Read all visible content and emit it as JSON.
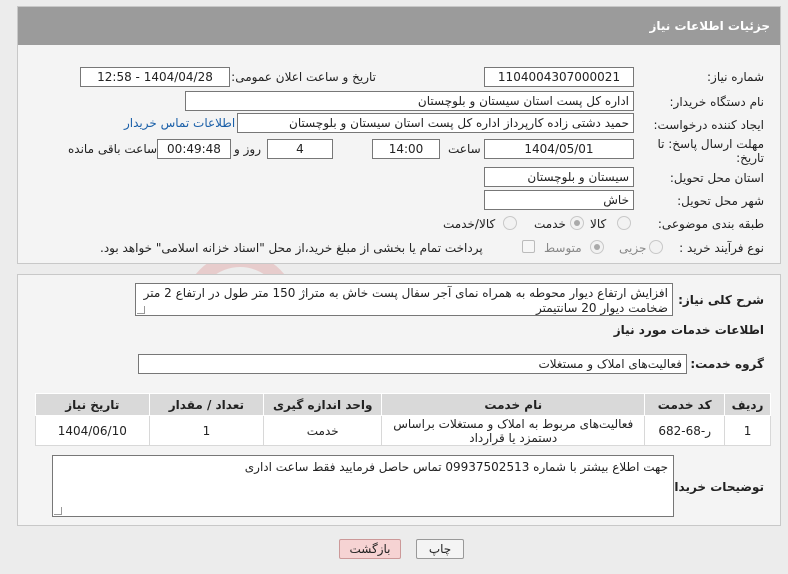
{
  "header": {
    "title": "جزئیات اطلاعات نیاز"
  },
  "fields": {
    "need_number_label": "شماره نیاز:",
    "need_number": "1104004307000021",
    "announce_label": "تاریخ و ساعت اعلان عمومی:",
    "announce_value": "1404/04/28 - 12:58",
    "buyer_org_label": "نام دستگاه خریدار:",
    "buyer_org": "اداره کل پست استان سیستان و بلوچستان",
    "requester_label": "ایجاد کننده درخواست:",
    "requester": "حمید دشتی زاده کارپرداز اداره کل پست استان سیستان و بلوچستان",
    "buyer_contact_link": "اطلاعات تماس خریدار",
    "deadline_label_1": "مهلت ارسال پاسخ: تا",
    "deadline_label_2": "تاریخ:",
    "deadline_date": "1404/05/01",
    "time_label": "ساعت",
    "deadline_time": "14:00",
    "days_value": "4",
    "days_label": "روز و",
    "remaining_time": "00:49:48",
    "remaining_label": "ساعت باقی مانده",
    "province_label": "استان محل تحویل:",
    "province": "سیستان و بلوچستان",
    "city_label": "شهر محل تحویل:",
    "city": "خاش",
    "category_label": "طبقه بندی موضوعی:",
    "category_options": [
      "کالا",
      "خدمت",
      "کالا/خدمت"
    ],
    "category_selected": "خدمت",
    "process_label": "نوع فرآیند خرید :",
    "process_options": [
      "جزیی",
      "متوسط"
    ],
    "process_selected": "متوسط",
    "payment_note": "پرداخت تمام یا بخشی از مبلغ خرید،از محل \"اسناد خزانه اسلامی\" خواهد بود."
  },
  "description": {
    "label": "شرح کلی نیاز:",
    "text": "افزایش ارتفاع دیوار محوطه به همراه نمای آجر سفال پست خاش به متراژ 150 متر طول در ارتفاع 2 متر ضخامت دیوار 20 سانتیمتر"
  },
  "services": {
    "heading": "اطلاعات خدمات مورد نیاز",
    "group_label": "گروه خدمت:",
    "group_value": "فعالیت‌های  املاک و مستغلات",
    "columns": [
      "ردیف",
      "کد خدمت",
      "نام خدمت",
      "واحد اندازه گیری",
      "تعداد / مقدار",
      "تاریخ نیاز"
    ],
    "rows": [
      {
        "index": "1",
        "code": "ر-68-682",
        "name": "فعالیت‌های مربوط به املاک و مستغلات براساس دستمزد یا قرارداد",
        "unit": "خدمت",
        "qty": "1",
        "date": "1404/06/10"
      }
    ]
  },
  "buyer_notes": {
    "label": "توضیحات خریدار:",
    "text": "جهت اطلاع بیشتر با شماره 09937502513 تماس حاصل فرمایید فقط ساعت اداری"
  },
  "buttons": {
    "print": "چاپ",
    "back": "بازگشت"
  },
  "watermark": "AriaTender.neT",
  "colors": {
    "header_bg": "#9b9b9b",
    "link": "#1a5fa8",
    "back_btn": "#f6d3d3"
  }
}
